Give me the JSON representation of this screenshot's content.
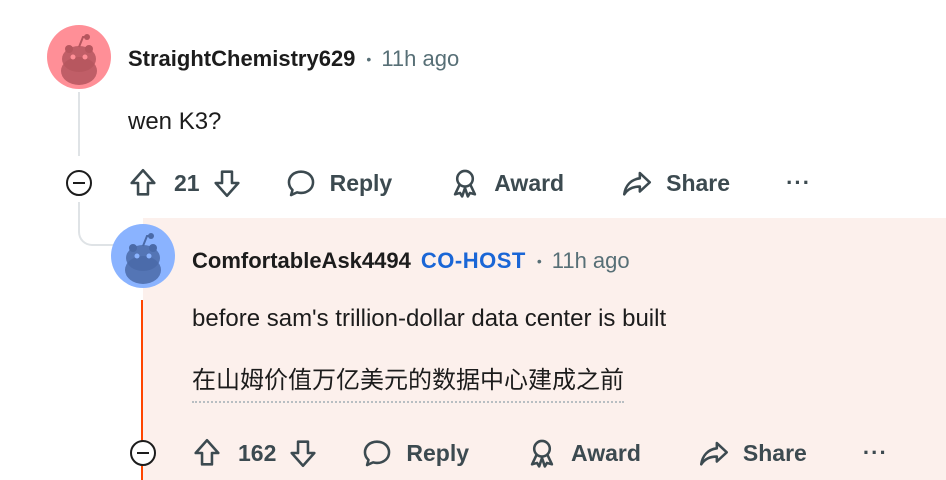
{
  "comments": [
    {
      "username": "StraightChemistry629",
      "separator": "•",
      "time": "11h ago",
      "body": "wen K3?",
      "votes": "21",
      "actions": {
        "reply": "Reply",
        "award": "Award",
        "share": "Share",
        "more": "···"
      },
      "avatar_color": "#ff8f97"
    },
    {
      "username": "ComfortableAsk4494",
      "badge": "CO-HOST",
      "separator": "•",
      "time": "11h ago",
      "body": "before sam's trillion-dollar data center is built",
      "translation": "在山姆价值万亿美元的数据中心建成之前",
      "votes": "162",
      "actions": {
        "reply": "Reply",
        "award": "Award",
        "share": "Share",
        "more": "···"
      },
      "avatar_color": "#8ab3ff",
      "badge_color": "#1a66d6",
      "highlight_color": "#fcf0ec",
      "thread_color": "#ff4500"
    }
  ],
  "icons": [
    "upvote-icon",
    "downvote-icon",
    "reply-icon",
    "award-icon",
    "share-icon",
    "collapse-icon",
    "more-icon",
    "avatar-icon"
  ]
}
